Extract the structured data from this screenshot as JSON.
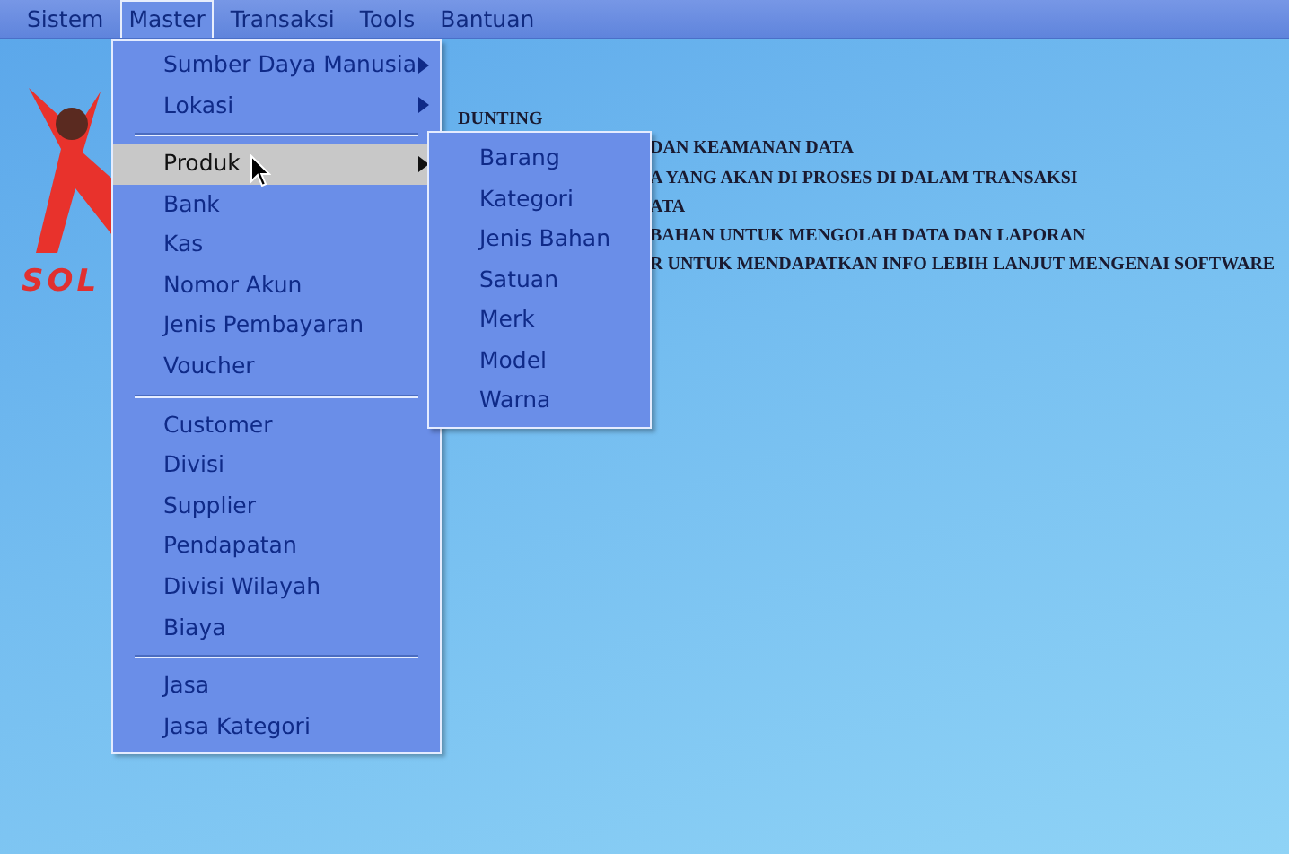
{
  "menubar": [
    {
      "label": "Sistem",
      "selected": false
    },
    {
      "label": "Master",
      "selected": true
    },
    {
      "label": "Transaksi",
      "selected": false
    },
    {
      "label": "Tools",
      "selected": false
    },
    {
      "label": "Bantuan",
      "selected": false
    }
  ],
  "logo": {
    "text": "SOL"
  },
  "background_text": {
    "heading": "DUNTING",
    "lines": [
      "DAN KEAMANAN DATA",
      "A YANG AKAN DI PROSES DI DALAM TRANSAKSI",
      "ATA",
      "BAHAN UNTUK MENGOLAH DATA DAN LAPORAN",
      "R UNTUK MENDAPATKAN INFO LEBIH LANJUT MENGENAI SOFTWARE"
    ]
  },
  "master_menu": [
    {
      "kind": "item",
      "label": "Sumber Daya Manusia",
      "submenu": true,
      "selected": false
    },
    {
      "kind": "item",
      "label": "Lokasi",
      "submenu": true,
      "selected": false
    },
    {
      "kind": "separator"
    },
    {
      "kind": "item",
      "label": "Produk",
      "submenu": true,
      "selected": true
    },
    {
      "kind": "item",
      "label": "Bank",
      "submenu": false,
      "selected": false
    },
    {
      "kind": "item",
      "label": "Kas",
      "submenu": false,
      "selected": false
    },
    {
      "kind": "item",
      "label": "Nomor Akun",
      "submenu": false,
      "selected": false
    },
    {
      "kind": "item",
      "label": "Jenis Pembayaran",
      "submenu": false,
      "selected": false
    },
    {
      "kind": "item",
      "label": "Voucher",
      "submenu": false,
      "selected": false
    },
    {
      "kind": "separator"
    },
    {
      "kind": "item",
      "label": "Customer",
      "submenu": false,
      "selected": false
    },
    {
      "kind": "item",
      "label": "Divisi",
      "submenu": false,
      "selected": false
    },
    {
      "kind": "item",
      "label": "Supplier",
      "submenu": false,
      "selected": false
    },
    {
      "kind": "item",
      "label": "Pendapatan",
      "submenu": false,
      "selected": false
    },
    {
      "kind": "item",
      "label": "Divisi Wilayah",
      "submenu": false,
      "selected": false
    },
    {
      "kind": "item",
      "label": "Biaya",
      "submenu": false,
      "selected": false
    },
    {
      "kind": "separator"
    },
    {
      "kind": "item",
      "label": "Jasa",
      "submenu": false,
      "selected": false
    },
    {
      "kind": "item",
      "label": "Jasa Kategori",
      "submenu": false,
      "selected": false
    }
  ],
  "produk_submenu": [
    {
      "label": "Barang",
      "selected": false
    },
    {
      "label": "Kategori",
      "selected": false
    },
    {
      "label": "Jenis Bahan",
      "selected": false
    },
    {
      "label": "Satuan",
      "selected": false
    },
    {
      "label": "Merk",
      "selected": false
    },
    {
      "label": "Model",
      "selected": false
    },
    {
      "label": "Warna",
      "selected": false
    }
  ]
}
